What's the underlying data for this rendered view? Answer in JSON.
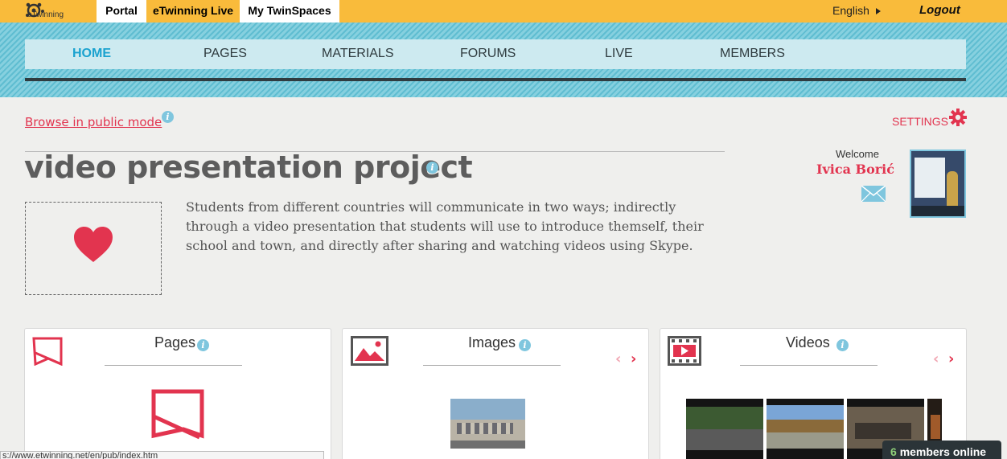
{
  "topbar": {
    "logo_text": "eTwinning",
    "tabs": [
      "Portal",
      "eTwinning Live",
      "My TwinSpaces"
    ],
    "language": "English",
    "logout": "Logout"
  },
  "nav": {
    "items": [
      "HOME",
      "PAGES",
      "MATERIALS",
      "FORUMS",
      "LIVE",
      "MEMBERS"
    ],
    "active": "HOME"
  },
  "browse_public": "Browse in public mode",
  "settings": "SETTINGS",
  "project": {
    "title": "video presentation project",
    "description": "Students from different countries will communicate in two ways; indirectly through a video presentation that students will use to introduce themself, their school and town, and directly after sharing and watching videos using Skype."
  },
  "user": {
    "welcome": "Welcome",
    "name": "Ivica Borić"
  },
  "cards": [
    {
      "title": "Pages"
    },
    {
      "title": "Images"
    },
    {
      "title": "Videos"
    }
  ],
  "status_url": "s://www.etwinning.net/en/pub/index.htm",
  "online": {
    "count": "6",
    "label": "members online"
  },
  "colors": {
    "accent": "#e2344f",
    "topbar": "#f9bb3b",
    "nav_active": "#1aa2cf",
    "info": "#7fc6de"
  }
}
